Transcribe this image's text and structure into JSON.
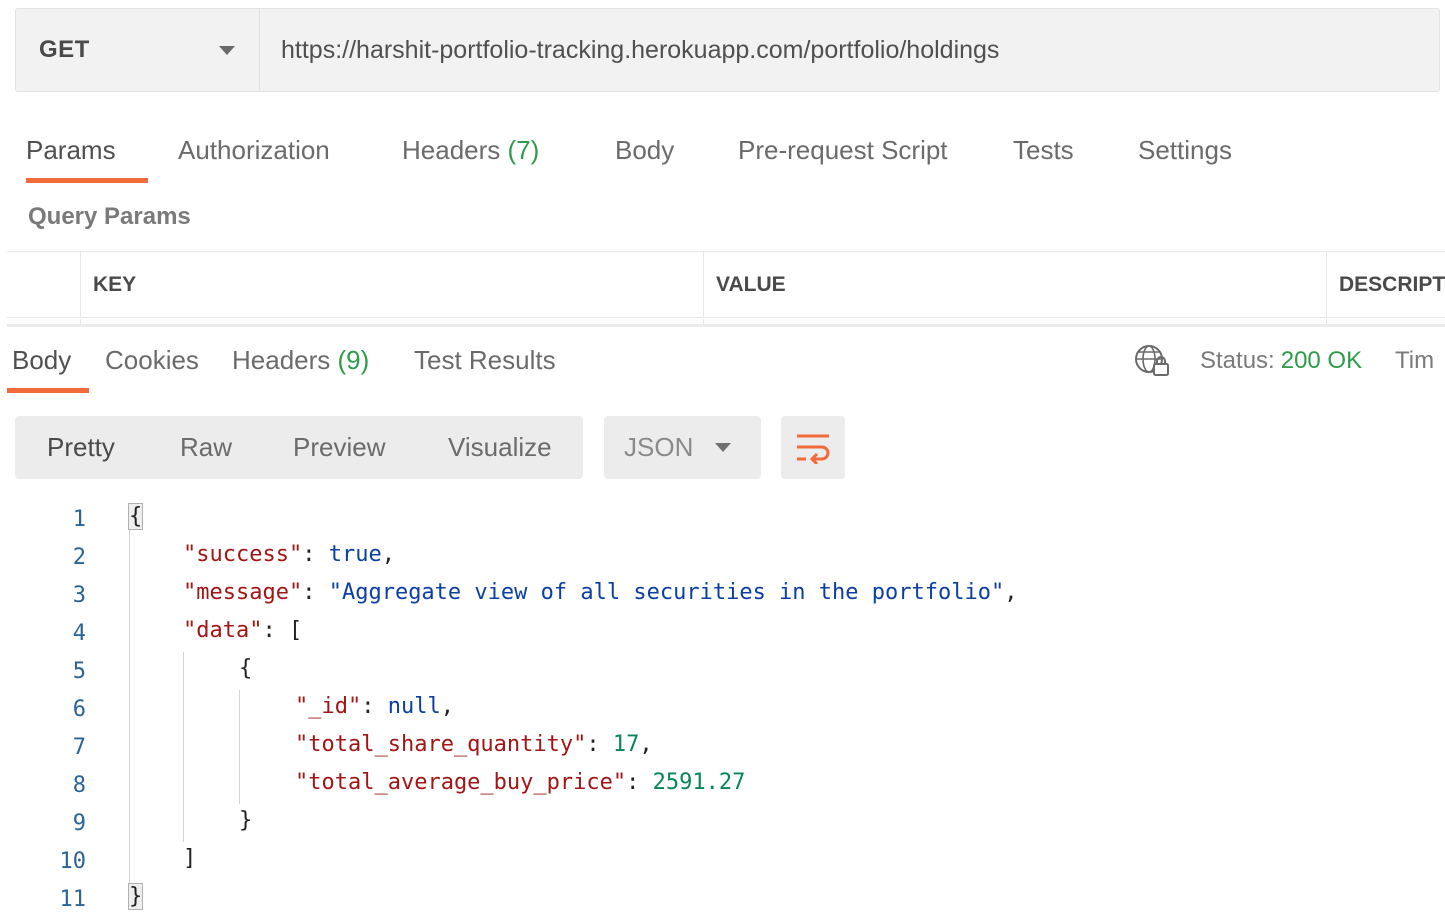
{
  "request": {
    "method": "GET",
    "url": "https://harshit-portfolio-tracking.herokuapp.com/portfolio/holdings"
  },
  "request_tabs": [
    {
      "label": "Params",
      "count": ""
    },
    {
      "label": "Authorization",
      "count": ""
    },
    {
      "label": "Headers",
      "count": "(7)"
    },
    {
      "label": "Body",
      "count": ""
    },
    {
      "label": "Pre-request Script",
      "count": ""
    },
    {
      "label": "Tests",
      "count": ""
    },
    {
      "label": "Settings",
      "count": ""
    }
  ],
  "query_params": {
    "title": "Query Params",
    "columns": [
      "KEY",
      "VALUE",
      "DESCRIPT"
    ]
  },
  "response_tabs": [
    {
      "label": "Body",
      "count": ""
    },
    {
      "label": "Cookies",
      "count": ""
    },
    {
      "label": "Headers",
      "count": "(9)"
    },
    {
      "label": "Test Results",
      "count": ""
    }
  ],
  "response_status": {
    "label": "Status:",
    "value": "200 OK",
    "time_label": "Tim"
  },
  "view_modes": [
    "Pretty",
    "Raw",
    "Preview",
    "Visualize"
  ],
  "format": "JSON",
  "colors": {
    "accent": "#f26b3a",
    "status_ok": "#2e9c4a",
    "json_key": "#a31515",
    "json_string": "#0b3fa3",
    "json_number": "#098658"
  },
  "code_lines": [
    {
      "n": "1",
      "tokens": [
        {
          "t": "{",
          "c": "p"
        }
      ]
    },
    {
      "n": "2",
      "tokens": [
        {
          "t": "\"success\"",
          "c": "k"
        },
        {
          "t": ": ",
          "c": "p"
        },
        {
          "t": "true",
          "c": "b"
        },
        {
          "t": ",",
          "c": "p"
        }
      ]
    },
    {
      "n": "3",
      "tokens": [
        {
          "t": "\"message\"",
          "c": "k"
        },
        {
          "t": ": ",
          "c": "p"
        },
        {
          "t": "\"Aggregate view of all securities in the portfolio\"",
          "c": "s"
        },
        {
          "t": ",",
          "c": "p"
        }
      ]
    },
    {
      "n": "4",
      "tokens": [
        {
          "t": "\"data\"",
          "c": "k"
        },
        {
          "t": ": [",
          "c": "p"
        }
      ]
    },
    {
      "n": "5",
      "tokens": [
        {
          "t": "{",
          "c": "p"
        }
      ]
    },
    {
      "n": "6",
      "tokens": [
        {
          "t": "\"_id\"",
          "c": "k"
        },
        {
          "t": ": ",
          "c": "p"
        },
        {
          "t": "null",
          "c": "b"
        },
        {
          "t": ",",
          "c": "p"
        }
      ]
    },
    {
      "n": "7",
      "tokens": [
        {
          "t": "\"total_share_quantity\"",
          "c": "k"
        },
        {
          "t": ": ",
          "c": "p"
        },
        {
          "t": "17",
          "c": "n"
        },
        {
          "t": ",",
          "c": "p"
        }
      ]
    },
    {
      "n": "8",
      "tokens": [
        {
          "t": "\"total_average_buy_price\"",
          "c": "k"
        },
        {
          "t": ": ",
          "c": "p"
        },
        {
          "t": "2591.27",
          "c": "n"
        }
      ]
    },
    {
      "n": "9",
      "tokens": [
        {
          "t": "}",
          "c": "p"
        }
      ]
    },
    {
      "n": "10",
      "tokens": [
        {
          "t": "]",
          "c": "p"
        }
      ]
    },
    {
      "n": "11",
      "tokens": [
        {
          "t": "}",
          "c": "p"
        }
      ]
    }
  ]
}
